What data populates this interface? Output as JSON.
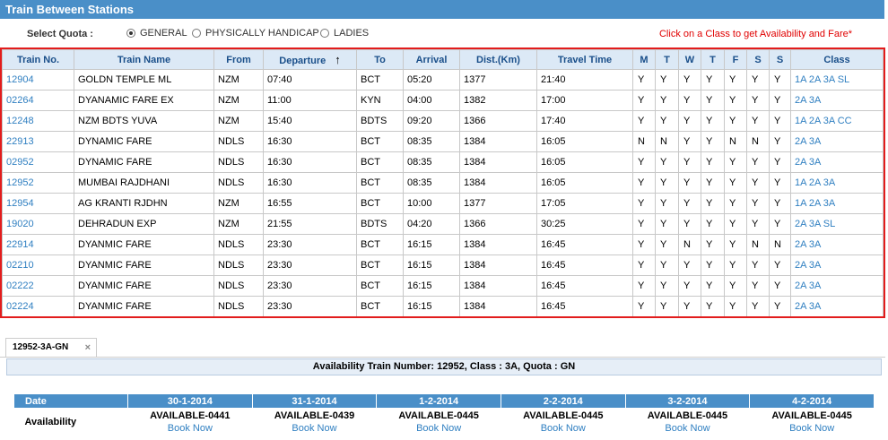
{
  "title": "Train Between Stations",
  "quota": {
    "label": "Select Quota :",
    "options": [
      {
        "label": "GENERAL",
        "checked": true
      },
      {
        "label": "PHYSICALLY HANDICAP",
        "checked": false
      },
      {
        "label": "LADIES",
        "checked": false
      }
    ],
    "hint": "Click on a Class to get Availability and Fare*"
  },
  "train_table": {
    "headers": [
      "Train No.",
      "Train Name",
      "From",
      "Departure",
      "To",
      "Arrival",
      "Dist.(Km)",
      "Travel Time",
      "M",
      "T",
      "W",
      "T",
      "F",
      "S",
      "S",
      "Class"
    ],
    "sort_icon": "arrow-up-icon",
    "rows": [
      [
        "12904",
        "GOLDN TEMPLE ML",
        "NZM",
        "07:40",
        "BCT",
        "05:20",
        "1377",
        "21:40",
        "Y",
        "Y",
        "Y",
        "Y",
        "Y",
        "Y",
        "Y",
        "1A 2A 3A SL"
      ],
      [
        "02264",
        "DYANAMIC FARE EX",
        "NZM",
        "11:00",
        "KYN",
        "04:00",
        "1382",
        "17:00",
        "Y",
        "Y",
        "Y",
        "Y",
        "Y",
        "Y",
        "Y",
        "2A 3A"
      ],
      [
        "12248",
        "NZM BDTS YUVA",
        "NZM",
        "15:40",
        "BDTS",
        "09:20",
        "1366",
        "17:40",
        "Y",
        "Y",
        "Y",
        "Y",
        "Y",
        "Y",
        "Y",
        "1A 2A 3A CC"
      ],
      [
        "22913",
        "DYNAMIC FARE",
        "NDLS",
        "16:30",
        "BCT",
        "08:35",
        "1384",
        "16:05",
        "N",
        "N",
        "Y",
        "Y",
        "N",
        "N",
        "Y",
        "2A 3A"
      ],
      [
        "02952",
        "DYNAMIC FARE",
        "NDLS",
        "16:30",
        "BCT",
        "08:35",
        "1384",
        "16:05",
        "Y",
        "Y",
        "Y",
        "Y",
        "Y",
        "Y",
        "Y",
        "2A 3A"
      ],
      [
        "12952",
        "MUMBAI RAJDHANI",
        "NDLS",
        "16:30",
        "BCT",
        "08:35",
        "1384",
        "16:05",
        "Y",
        "Y",
        "Y",
        "Y",
        "Y",
        "Y",
        "Y",
        "1A 2A 3A"
      ],
      [
        "12954",
        "AG KRANTI RJDHN",
        "NZM",
        "16:55",
        "BCT",
        "10:00",
        "1377",
        "17:05",
        "Y",
        "Y",
        "Y",
        "Y",
        "Y",
        "Y",
        "Y",
        "1A 2A 3A"
      ],
      [
        "19020",
        "DEHRADUN EXP",
        "NZM",
        "21:55",
        "BDTS",
        "04:20",
        "1366",
        "30:25",
        "Y",
        "Y",
        "Y",
        "Y",
        "Y",
        "Y",
        "Y",
        "2A 3A SL"
      ],
      [
        "22914",
        "DYANMIC FARE",
        "NDLS",
        "23:30",
        "BCT",
        "16:15",
        "1384",
        "16:45",
        "Y",
        "Y",
        "N",
        "Y",
        "Y",
        "N",
        "N",
        "2A 3A"
      ],
      [
        "02210",
        "DYANMIC FARE",
        "NDLS",
        "23:30",
        "BCT",
        "16:15",
        "1384",
        "16:45",
        "Y",
        "Y",
        "Y",
        "Y",
        "Y",
        "Y",
        "Y",
        "2A 3A"
      ],
      [
        "02222",
        "DYANMIC FARE",
        "NDLS",
        "23:30",
        "BCT",
        "16:15",
        "1384",
        "16:45",
        "Y",
        "Y",
        "Y",
        "Y",
        "Y",
        "Y",
        "Y",
        "2A 3A"
      ],
      [
        "02224",
        "DYANMIC FARE",
        "NDLS",
        "23:30",
        "BCT",
        "16:15",
        "1384",
        "16:45",
        "Y",
        "Y",
        "Y",
        "Y",
        "Y",
        "Y",
        "Y",
        "2A 3A"
      ]
    ]
  },
  "tab": {
    "label": "12952-3A-GN",
    "close": "×"
  },
  "availability": {
    "title": "Availability Train Number: 12952, Class : 3A, Quota : GN",
    "date_label": "Date",
    "row_label": "Availability",
    "book_label": "Book Now",
    "columns": [
      {
        "date": "30-1-2014",
        "status": "AVAILABLE-0441"
      },
      {
        "date": "31-1-2014",
        "status": "AVAILABLE-0439"
      },
      {
        "date": "1-2-2014",
        "status": "AVAILABLE-0445"
      },
      {
        "date": "2-2-2014",
        "status": "AVAILABLE-0445"
      },
      {
        "date": "3-2-2014",
        "status": "AVAILABLE-0445"
      },
      {
        "date": "4-2-2014",
        "status": "AVAILABLE-0445"
      }
    ]
  },
  "colors": {
    "header_blue": "#4a8fc8",
    "link_blue": "#2f7fc1",
    "highlight_red": "#e21c1c",
    "hint_red": "#e00000"
  }
}
